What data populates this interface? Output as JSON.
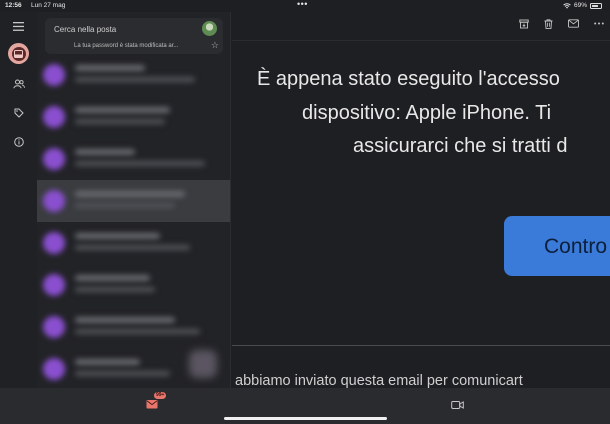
{
  "status": {
    "time": "12:56",
    "date": "Lun 27 mag",
    "battery": "69%",
    "battery_level": 0.69
  },
  "rail": {
    "items": [
      {
        "name": "menu-icon"
      },
      {
        "name": "inbox-icon",
        "active": true
      },
      {
        "name": "contacts-icon"
      },
      {
        "name": "tag-icon"
      },
      {
        "name": "info-icon"
      }
    ]
  },
  "search": {
    "placeholder": "Cerca nella posta",
    "notice": "La tua password è stata modificata ar..."
  },
  "list": {
    "rows": [
      {
        "color": "#8a4fcf",
        "selected": false
      },
      {
        "color": "#8a4fcf",
        "selected": false
      },
      {
        "color": "#8a4fcf",
        "selected": false
      },
      {
        "color": "#8a4fcf",
        "selected": true
      },
      {
        "color": "#8a4fcf",
        "selected": false
      },
      {
        "color": "#8a4fcf",
        "selected": false
      },
      {
        "color": "#8a4fcf",
        "selected": false
      },
      {
        "color": "#8a4fcf",
        "selected": false
      },
      {
        "color": "#d04a9a",
        "selected": false
      }
    ]
  },
  "reader": {
    "line1": "È appena stato eseguito l'accesso",
    "line2": "dispositivo: Apple iPhone. Ti",
    "line3": "assicurarci che si tratti d",
    "cta_label": "Contro",
    "footer": "abbiamo inviato questa email per comunicart"
  },
  "bottombar": {
    "mail_badge": "99+"
  },
  "colors": {
    "accent": "#3a7ad9",
    "badge": "#e8756b",
    "active_rail": "#e3a7a0"
  }
}
